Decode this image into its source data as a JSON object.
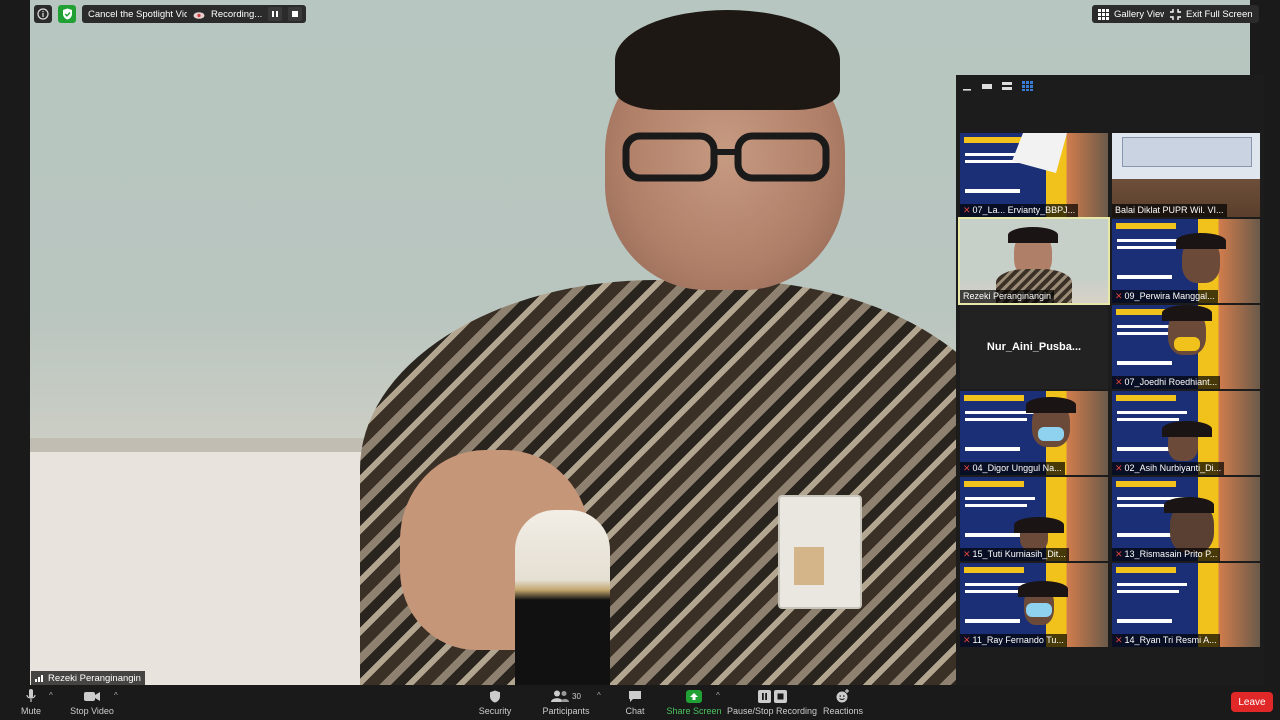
{
  "top_bar": {
    "info_icon": "info-icon",
    "security_icon": "shield-icon",
    "spotlight_label": "Cancel the Spotlight Video",
    "recording_label": "Recording...",
    "gallery_view_label": "Gallery View",
    "exit_fullscreen_label": "Exit Full Screen"
  },
  "main_video": {
    "speaker_name": "Rezeki Peranginangin"
  },
  "participants_panel": {
    "tiles": [
      {
        "name": "07_La... Ervianty_BBPJ...",
        "muted": true
      },
      {
        "name": "Balai Diklat PUPR Wil. VI...",
        "muted": false
      },
      {
        "name": "Rezeki Peranginangin",
        "muted": false
      },
      {
        "name": "09_Perwira Manggal...",
        "muted": true
      },
      {
        "name": "Nur_Aini_Pusba...",
        "muted": false
      },
      {
        "name": "07_Joedhi Roedhiant...",
        "muted": true
      },
      {
        "name": "04_Digor Unggul Na...",
        "muted": true
      },
      {
        "name": "02_Asih Nurbiyanti_Di...",
        "muted": true
      },
      {
        "name": "15_Tuti Kurniasih_Dit...",
        "muted": true
      },
      {
        "name": "13_Rismasain Prito P...",
        "muted": true
      },
      {
        "name": "11_Ray Fernando Tu...",
        "muted": true
      },
      {
        "name": "14_Ryan Tri Resmi A...",
        "muted": true
      }
    ]
  },
  "toolbar": {
    "mute_label": "Mute",
    "stop_video_label": "Stop Video",
    "security_label": "Security",
    "participants_label": "Participants",
    "participants_count": "30",
    "chat_label": "Chat",
    "share_screen_label": "Share Screen",
    "pause_recording_label": "Pause/Stop Recording",
    "reactions_label": "Reactions",
    "leave_label": "Leave"
  },
  "colors": {
    "share_green": "#21a034",
    "leave_red": "#e02828",
    "toolbar_bg": "#1a1a1a",
    "active_outline": "#e7e7a8"
  }
}
